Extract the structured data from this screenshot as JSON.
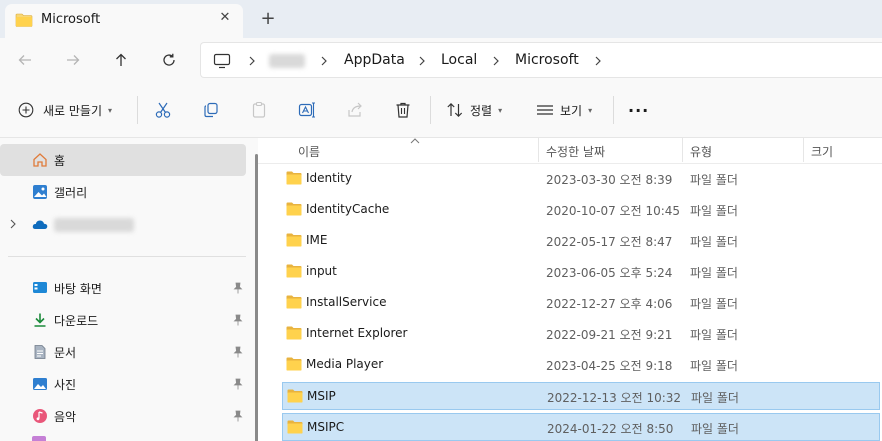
{
  "tab": {
    "title": "Microsoft",
    "close": "✕",
    "new": "+"
  },
  "address": {
    "crumbs": [
      "AppData",
      "Local",
      "Microsoft"
    ],
    "nav": {
      "back": "back-icon",
      "forward": "forward-icon",
      "up": "up-icon",
      "refresh": "refresh-icon"
    }
  },
  "commands": {
    "new_label": "새로 만들기",
    "sort_label": "정렬",
    "view_label": "보기",
    "more_label": "···"
  },
  "sidebar": {
    "items": [
      {
        "label": "홈",
        "icon": "home-icon"
      },
      {
        "label": "갤러리",
        "icon": "gallery-icon"
      }
    ],
    "quick_access": [
      {
        "label": "바탕 화면",
        "icon": "desktop-icon"
      },
      {
        "label": "다운로드",
        "icon": "download-icon"
      },
      {
        "label": "문서",
        "icon": "documents-icon"
      },
      {
        "label": "사진",
        "icon": "pictures-icon"
      },
      {
        "label": "음악",
        "icon": "music-icon"
      }
    ]
  },
  "columns": {
    "name": "이름",
    "modified": "수정한 날짜",
    "type": "유형",
    "size": "크기"
  },
  "files": [
    {
      "name": "Identity",
      "modified": "2023-03-30 오전 8:39",
      "type": "파일 폴더"
    },
    {
      "name": "IdentityCache",
      "modified": "2020-10-07 오전 10:45",
      "type": "파일 폴더"
    },
    {
      "name": "IME",
      "modified": "2022-05-17 오전 8:47",
      "type": "파일 폴더"
    },
    {
      "name": "input",
      "modified": "2023-06-05 오후 5:24",
      "type": "파일 폴더"
    },
    {
      "name": "InstallService",
      "modified": "2022-12-27 오후 4:06",
      "type": "파일 폴더"
    },
    {
      "name": "Internet Explorer",
      "modified": "2022-09-21 오전 9:21",
      "type": "파일 폴더"
    },
    {
      "name": "Media Player",
      "modified": "2023-04-25 오전 9:18",
      "type": "파일 폴더"
    },
    {
      "name": "MSIP",
      "modified": "2022-12-13 오전 10:32",
      "type": "파일 폴더"
    },
    {
      "name": "MSIPC",
      "modified": "2024-01-22 오전 8:50",
      "type": "파일 폴더"
    }
  ],
  "colors": {
    "accent": "#005fb8",
    "folder": "#f8d775",
    "selection": "#cce4f7"
  }
}
